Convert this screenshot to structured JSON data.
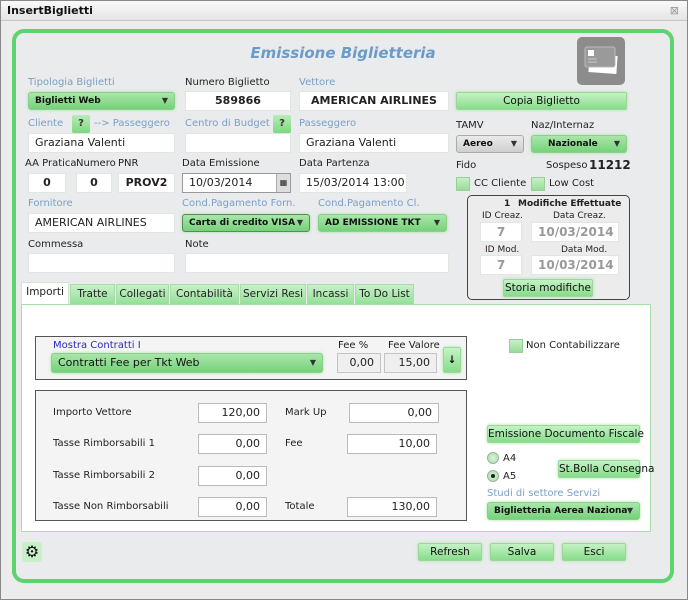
{
  "window": {
    "title": "InsertBiglietti",
    "close_icon": "close-icon"
  },
  "header": {
    "title": "Emissione Biglietteria",
    "icon": "credit-card-icon"
  },
  "form": {
    "tipologia_label": "Tipologia Biglietti",
    "tipologia_value": "Biglietti Web",
    "numero_label": "Numero Biglietto",
    "numero_value": "589866",
    "vettore_label": "Vettore",
    "vettore_value": "AMERICAN AIRLINES",
    "copia_button": "Copia Biglietto",
    "cliente_label": "Cliente",
    "help_label": "?",
    "passeggero_link": "--> Passeggero",
    "cliente_value": "Graziana Valenti",
    "centro_label": "Centro di Budget",
    "centro_value": "",
    "passeggero_label": "Passeggero",
    "passeggero_value": "Graziana Valenti",
    "tamv_label": "TAMV",
    "tamv_value": "Aereo",
    "naz_label": "Naz/Internaz",
    "naz_value": "Nazionale",
    "aa_pratica_label": "AA Pratica",
    "aa_pratica_value": "0",
    "numero_pratica_label": "Numero",
    "numero_pratica_value": "0",
    "pnr_label": "PNR",
    "pnr_value": "PROV2",
    "data_emissione_label": "Data Emissione",
    "data_emissione_value": "10/03/2014",
    "data_partenza_label": "Data Partenza",
    "data_partenza_value": "15/03/2014 13:00",
    "fido_label": "Fido",
    "sospeso_label": "Sospeso",
    "sospeso_value": "11212",
    "cc_cliente_label": "CC Cliente",
    "low_cost_label": "Low Cost",
    "fornitore_label": "Fornitore",
    "fornitore_value": "AMERICAN AIRLINES",
    "cond_forn_label": "Cond.Pagamento Forn.",
    "cond_forn_value": "Carta di credito VISA",
    "cond_cl_label": "Cond.Pagamento Cl.",
    "cond_cl_value": "AD EMISSIONE TKT",
    "commessa_label": "Commessa",
    "commessa_value": "",
    "note_label": "Note",
    "note_value": ""
  },
  "modifiche": {
    "count": "1",
    "title": "Modifiche Effettuate",
    "id_creaz_label": "ID Creaz.",
    "id_creaz_value": "7",
    "data_creaz_label": "Data Creaz.",
    "data_creaz_value": "10/03/2014",
    "id_mod_label": "ID Mod.",
    "id_mod_value": "7",
    "data_mod_label": "Data Mod.",
    "data_mod_value": "10/03/2014",
    "storia_button": "Storia modifiche"
  },
  "tabs": [
    {
      "label": "Importi",
      "active": true
    },
    {
      "label": "Tratte"
    },
    {
      "label": "Collegati"
    },
    {
      "label": "Contabilità"
    },
    {
      "label": "Servizi Resi"
    },
    {
      "label": "Incassi"
    },
    {
      "label": "To Do List"
    }
  ],
  "importi": {
    "contratti_label": "Mostra Contratti I",
    "contratti_value": "Contratti Fee per Tkt Web",
    "fee_pct_label": "Fee %",
    "fee_pct_value": "0,00",
    "fee_valore_label": "Fee Valore",
    "fee_valore_value": "15,00",
    "apply_icon": "↓",
    "non_contab_label": "Non Contabilizzare",
    "importo_vettore_label": "Importo Vettore",
    "importo_vettore_value": "120,00",
    "markup_label": "Mark Up",
    "markup_value": "0,00",
    "tasse_r1_label": "Tasse Rimborsabili 1",
    "tasse_r1_value": "0,00",
    "fee_label": "Fee",
    "fee_value": "10,00",
    "tasse_r2_label": "Tasse Rimborsabili 2",
    "tasse_r2_value": "0,00",
    "tasse_nr_label": "Tasse Non Rimborsabili",
    "tasse_nr_value": "0,00",
    "totale_label": "Totale",
    "totale_value": "130,00",
    "emissione_button": "Emissione Documento Fiscale",
    "a4_label": "A4",
    "a5_label": "A5",
    "format_selected": "A5",
    "bolla_button": "St.Bolla Consegna",
    "studi_label": "Studi di settore Servizi",
    "studi_value": "Biglietteria Aerea Naziona"
  },
  "footer": {
    "refresh": "Refresh",
    "salva": "Salva",
    "esci": "Esci"
  }
}
